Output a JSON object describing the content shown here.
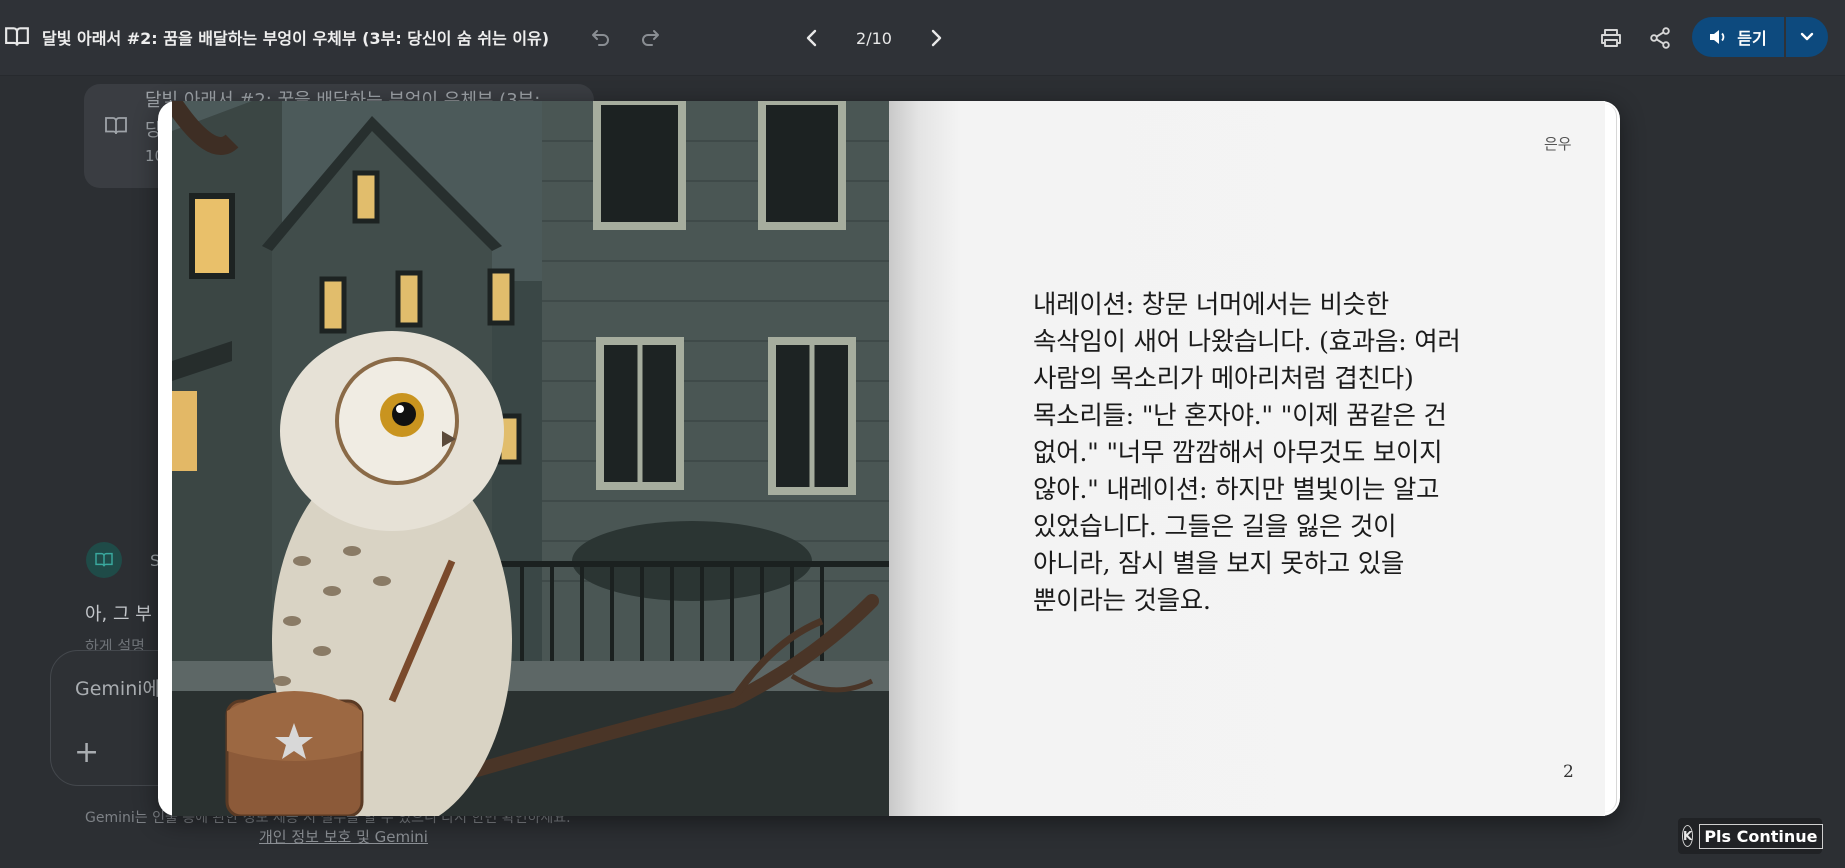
{
  "header": {
    "title": "달빛 아래서 #2: 꿈을 배달하는 부엉이 우체부 (3부: 당신이 숨 쉬는 이유)",
    "page_indicator": "2/10",
    "listen_label": "듣기"
  },
  "background": {
    "card_title_line1": "달빛 아래서 #2: 꿈을 배달하는 부엉이 우체부 (3부:",
    "card_title_line2": "당",
    "card_subtitle": "10",
    "sender": "S",
    "message": "아, 그 부",
    "message_faded": "하게 설명",
    "input_placeholder": "Gemini에",
    "plus_label": "+",
    "disclaimer": "Gemini는 인물 등에 관한 정보 제공 시 실수를 할 수 있으니 다시 한번 확인하세요.",
    "privacy_link": "개인 정보 보호 및 Gemini"
  },
  "book": {
    "author": "은우",
    "text": "내레이션: 창문 너머에서는 비슷한 속삭임이 새어 나왔습니다. (효과음: 여러 사람의 목소리가 메아리처럼 겹친다) 목소리들: \"난 혼자야.\" \"이제 꿈같은 건 없어.\" \"너무 깜깜해서 아무것도 보이지 않아.\" 내레이션: 하지만 별빛이는 알고 있었습니다. 그들은 길을 잃은 것이 아니라, 잠시 별을 보지 못하고 있을 뿐이라는 것을요.",
    "page_number": "2"
  },
  "extension": {
    "badge": "K",
    "label": "Pls Continue"
  },
  "colors": {
    "listen_button": "#0d4a7e",
    "topbar": "#2f3237",
    "background": "#2c2f33"
  }
}
